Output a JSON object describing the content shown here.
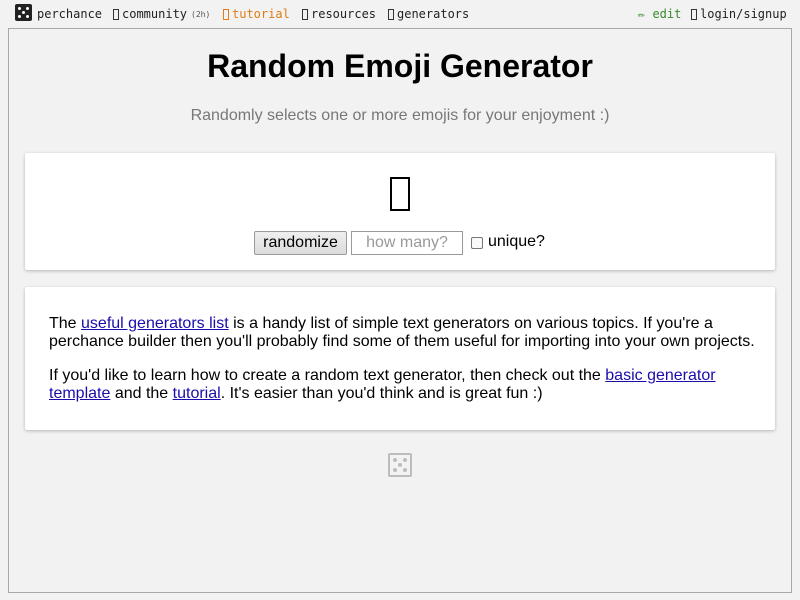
{
  "nav": {
    "brand": "perchance",
    "community": "community",
    "community_badge": "(2h)",
    "tutorial": "tutorial",
    "resources": "resources",
    "generators": "generators",
    "edit": "✏ edit",
    "login": "login/signup"
  },
  "page": {
    "title": "Random Emoji Generator",
    "subtitle": "Randomly selects one or more emojis for your enjoyment :)"
  },
  "controls": {
    "randomize_label": "randomize",
    "howmany_placeholder": "how many?",
    "unique_label": "unique?",
    "unique_checked": false
  },
  "info": {
    "p1_start": "The ",
    "p1_link": "useful generators list",
    "p1_end": " is a handy list of simple text generators on various topics. If you're a perchance builder then you'll probably find some of them useful for importing into your own projects.",
    "p2_start": "If you'd like to learn how to create a random text generator, then check out the ",
    "p2_link1": "basic generator template",
    "p2_mid": " and the ",
    "p2_link2": "tutorial",
    "p2_end": ". It's easier than you'd think and is great fun :)"
  },
  "colors": {
    "accent_orange": "#e07b17",
    "edit_green": "#3a8a2e",
    "link_blue": "#1a0dab"
  }
}
